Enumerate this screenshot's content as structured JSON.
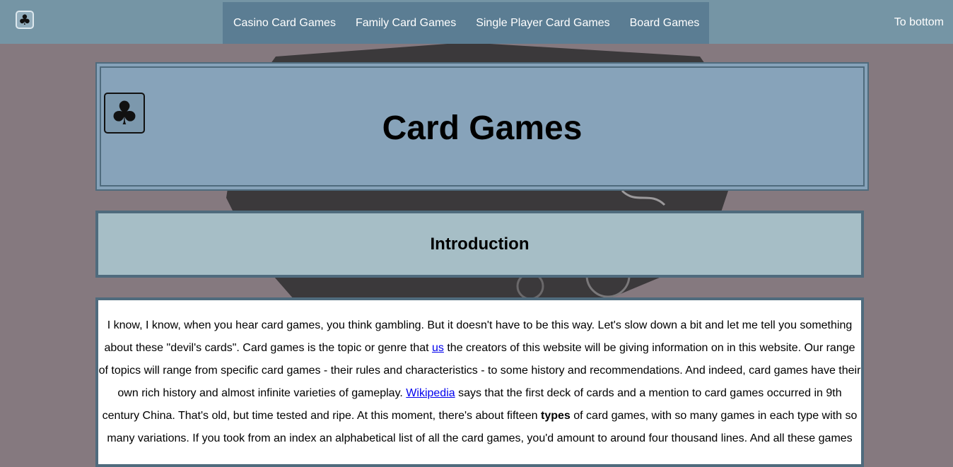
{
  "nav": {
    "logo_icon": "club-icon",
    "links": [
      "Casino Card Games",
      "Family Card Games",
      "Single Player Card Games",
      "Board Games"
    ],
    "to_bottom": "To bottom"
  },
  "header": {
    "icon": "club-icon",
    "title": "Card Games"
  },
  "intro": {
    "title": "Introduction"
  },
  "content": {
    "p1": "I know, I know, when you hear card games, you think gambling. But it doesn't have to be this way. Let's slow down a bit and let me tell you something about these \"devil's cards\". Card games is the topic or genre that ",
    "link_us": "us",
    "p2": " the creators of this website will be giving information on in this website. Our range of topics will range from specific card games - their rules and characteristics - to some history and recommendations. And indeed, card games have their own rich history and almost infinite varieties of gameplay. ",
    "link_wikipedia": "Wikipedia",
    "p3": " says that the first deck of cards and a mention to card games occurred in 9th century China. That's old, but time tested and ripe. At this moment, there's about fifteen ",
    "bold_types": "types",
    "p4": " of card games, with so many games in each type with so many variations. If you took from an index an alphabetical list of all the card games, you'd amount to around four thousand lines. And all these games"
  },
  "colors": {
    "navbar": "#7595a5",
    "nav_group": "#5b7d93",
    "page_bg": "#85797f",
    "header_bg": "#87a3ba",
    "intro_bg": "#a6bec6",
    "border": "#4f6b7d"
  }
}
